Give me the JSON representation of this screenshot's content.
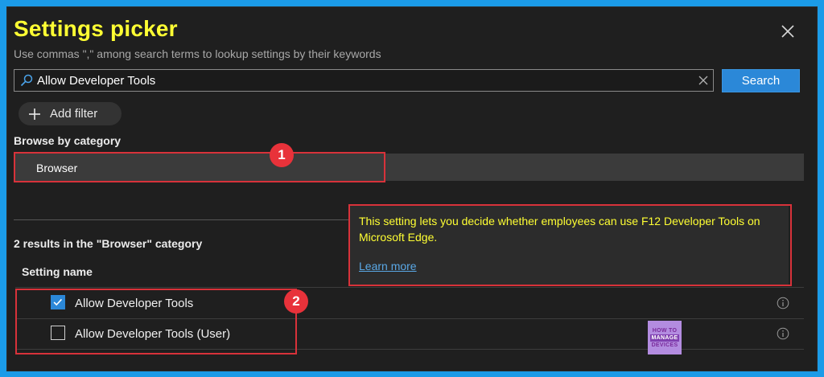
{
  "dialog": {
    "title": "Settings picker",
    "subtitle": "Use commas \",\" among search terms to lookup settings by their keywords"
  },
  "search": {
    "value": "Allow Developer Tools",
    "button_label": "Search"
  },
  "filter": {
    "add_label": "Add filter"
  },
  "browse": {
    "label": "Browse by category",
    "categories": [
      "Browser"
    ]
  },
  "results": {
    "summary": "2 results in the \"Browser\" category",
    "column_header": "Setting name",
    "rows": [
      {
        "label": "Allow Developer Tools",
        "checked": true
      },
      {
        "label": "Allow Developer Tools (User)",
        "checked": false
      }
    ]
  },
  "tooltip": {
    "text": "This setting lets you decide whether employees can use F12 Developer Tools on Microsoft Edge.",
    "link": "Learn more"
  },
  "annotations": {
    "badge1": "1",
    "badge2": "2"
  },
  "logo": {
    "line1": "HOW TO",
    "line2": "MANAGE",
    "line3": "DEVICES"
  },
  "colors": {
    "accent": "#2b88d8",
    "title": "#ffff33",
    "callout": "#d8323a",
    "frame": "#1b9be8"
  },
  "icons": [
    "close-icon",
    "search-icon",
    "clear-icon",
    "plus-icon",
    "checkbox-checked-icon",
    "info-icon"
  ]
}
